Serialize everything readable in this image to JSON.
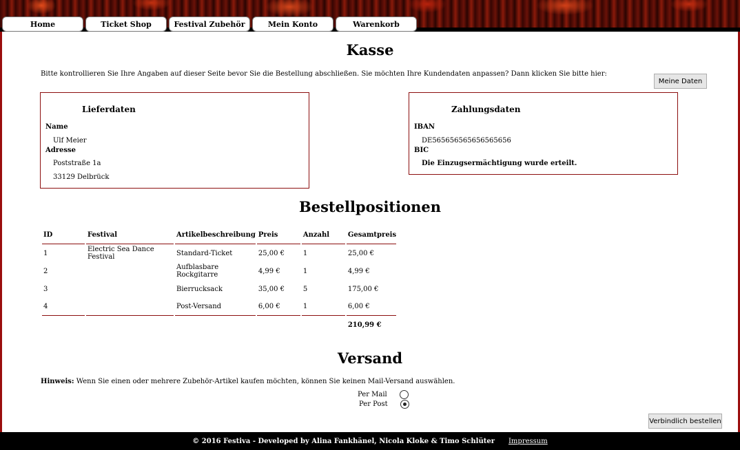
{
  "nav": [
    "Home",
    "Ticket Shop",
    "Festival Zubehör",
    "Mein Konto",
    "Warenkorb"
  ],
  "page_title": "Kasse",
  "intro_text": "Bitte kontrollieren Sie Ihre Angaben auf dieser Seite bevor Sie die Bestellung abschließen. Sie möchten Ihre Kundendaten anpassen? Dann klicken Sie bitte hier:",
  "my_data_button": "Meine Daten",
  "delivery": {
    "title": "Lieferdaten",
    "name_label": "Name",
    "name": "Ulf Meier",
    "address_label": "Adresse",
    "street": "Poststraße 1a",
    "city": "33129 Delbrück"
  },
  "payment": {
    "title": "Zahlungsdaten",
    "iban_label": "IBAN",
    "iban": "DE565656565656565656",
    "bic_label": "BIC",
    "mandate": "Die Einzugsermächtigung wurde erteilt."
  },
  "positions_title": "Bestellpositionen",
  "table": {
    "headers": [
      "ID",
      "Festival",
      "Artikelbeschreibung",
      "Preis",
      "Anzahl",
      "Gesamtpreis"
    ],
    "rows": [
      [
        "1",
        "Electric Sea Dance Festival",
        "Standard-Ticket",
        "25,00 €",
        "1",
        "25,00 €"
      ],
      [
        "2",
        "",
        "Aufblasbare Rockgitarre",
        "4,99 €",
        "1",
        "4,99 €"
      ],
      [
        "3",
        "",
        "Bierrucksack",
        "35,00 €",
        "5",
        "175,00 €"
      ],
      [
        "4",
        "",
        "Post-Versand",
        "6,00 €",
        "1",
        "6,00 €"
      ]
    ],
    "total": "210,99 €"
  },
  "shipping": {
    "title": "Versand",
    "hint_label": "Hinweis:",
    "hint_text": " Wenn Sie einen oder mehrere Zubehör-Artikel kaufen möchten, können Sie keinen Mail-Versand auswählen.",
    "options": [
      {
        "label": "Per Mail",
        "checked": false
      },
      {
        "label": "Per Post",
        "checked": true
      }
    ]
  },
  "order_button": "Verbindlich bestellen",
  "footer": {
    "text": "© 2016 Festiva - Developed by Alina Fankhänel, Nicola Kloke & Timo Schlüter",
    "link": "Impressum"
  }
}
